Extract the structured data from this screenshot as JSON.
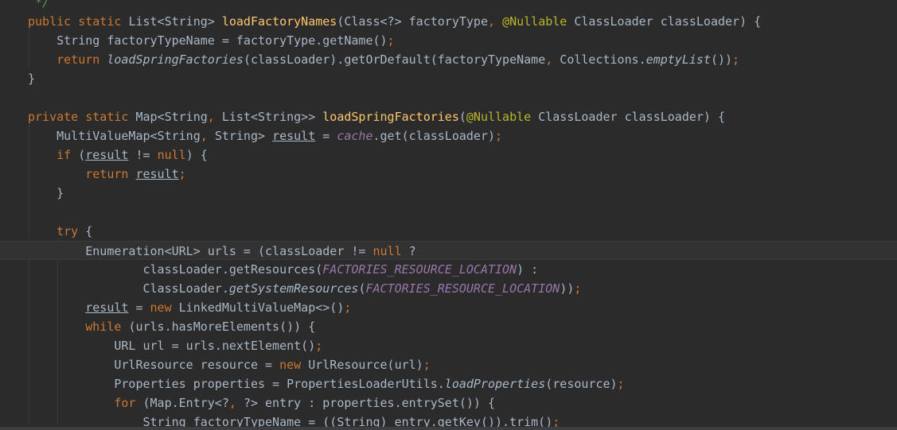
{
  "editor": {
    "lines": [
      {
        "tokens": [
          {
            "t": " */",
            "c": "cm"
          }
        ]
      },
      {
        "tokens": [
          {
            "t": "public static ",
            "c": "kw"
          },
          {
            "t": "List<String> ",
            "c": "pl"
          },
          {
            "t": "loadFactoryNames",
            "c": "fn"
          },
          {
            "t": "(Class<?> factoryType",
            "c": "pl"
          },
          {
            "t": ", ",
            "c": "kw"
          },
          {
            "t": "@Nullable ",
            "c": "ann"
          },
          {
            "t": "ClassLoader classLoader) {",
            "c": "pl"
          }
        ]
      },
      {
        "tokens": [
          {
            "t": "    String factoryTypeName = factoryType.getName()",
            "c": "pl"
          },
          {
            "t": ";",
            "c": "kw"
          }
        ]
      },
      {
        "tokens": [
          {
            "t": "    return ",
            "c": "kw"
          },
          {
            "t": "loadSpringFactories",
            "c": "it"
          },
          {
            "t": "(classLoader).getOrDefault(factoryTypeName",
            "c": "pl"
          },
          {
            "t": ", ",
            "c": "kw"
          },
          {
            "t": "Collections.",
            "c": "pl"
          },
          {
            "t": "emptyList",
            "c": "it"
          },
          {
            "t": "())",
            "c": "pl"
          },
          {
            "t": ";",
            "c": "kw"
          }
        ]
      },
      {
        "tokens": [
          {
            "t": "}",
            "c": "pl"
          }
        ]
      },
      {
        "tokens": []
      },
      {
        "tokens": [
          {
            "t": "private static ",
            "c": "kw"
          },
          {
            "t": "Map<String",
            "c": "pl"
          },
          {
            "t": ", ",
            "c": "kw"
          },
          {
            "t": "List<String>> ",
            "c": "pl"
          },
          {
            "t": "loadSpringFactories",
            "c": "fn"
          },
          {
            "t": "(",
            "c": "pl"
          },
          {
            "t": "@Nullable ",
            "c": "ann"
          },
          {
            "t": "ClassLoader classLoader) {",
            "c": "pl"
          }
        ]
      },
      {
        "tokens": [
          {
            "t": "    MultiValueMap<String",
            "c": "pl"
          },
          {
            "t": ", ",
            "c": "kw"
          },
          {
            "t": "String> ",
            "c": "pl"
          },
          {
            "t": "result",
            "c": "ul"
          },
          {
            "t": " = ",
            "c": "pl"
          },
          {
            "t": "cache",
            "c": "fld"
          },
          {
            "t": ".get(classLoader)",
            "c": "pl"
          },
          {
            "t": ";",
            "c": "kw"
          }
        ]
      },
      {
        "tokens": [
          {
            "t": "    if ",
            "c": "kw"
          },
          {
            "t": "(",
            "c": "pl"
          },
          {
            "t": "result",
            "c": "ul"
          },
          {
            "t": " != ",
            "c": "pl"
          },
          {
            "t": "null",
            "c": "kw"
          },
          {
            "t": ") {",
            "c": "pl"
          }
        ]
      },
      {
        "tokens": [
          {
            "t": "        return ",
            "c": "kw"
          },
          {
            "t": "result",
            "c": "ul"
          },
          {
            "t": ";",
            "c": "kw"
          }
        ]
      },
      {
        "tokens": [
          {
            "t": "    }",
            "c": "pl"
          }
        ]
      },
      {
        "tokens": []
      },
      {
        "tokens": [
          {
            "t": "    try ",
            "c": "kw"
          },
          {
            "t": "{",
            "c": "pl"
          }
        ]
      },
      {
        "tokens": [
          {
            "t": "        Enumeration<URL> urls = (classLoader != ",
            "c": "pl"
          },
          {
            "t": "null ",
            "c": "kw"
          },
          {
            "t": "?",
            "c": "pl"
          }
        ],
        "current": true
      },
      {
        "tokens": [
          {
            "t": "                classLoader.getResources(",
            "c": "pl"
          },
          {
            "t": "FACTORIES_RESOURCE_LOCATION",
            "c": "fld"
          },
          {
            "t": ") :",
            "c": "pl"
          }
        ]
      },
      {
        "tokens": [
          {
            "t": "                ClassLoader.",
            "c": "pl"
          },
          {
            "t": "getSystemResources",
            "c": "it"
          },
          {
            "t": "(",
            "c": "pl"
          },
          {
            "t": "FACTORIES_RESOURCE_LOCATION",
            "c": "fld"
          },
          {
            "t": "))",
            "c": "pl"
          },
          {
            "t": ";",
            "c": "kw"
          }
        ]
      },
      {
        "tokens": [
          {
            "t": "        ",
            "c": "pl"
          },
          {
            "t": "result",
            "c": "ul"
          },
          {
            "t": " = ",
            "c": "pl"
          },
          {
            "t": "new ",
            "c": "kw"
          },
          {
            "t": "LinkedMultiValueMap<>()",
            "c": "pl"
          },
          {
            "t": ";",
            "c": "kw"
          }
        ]
      },
      {
        "tokens": [
          {
            "t": "        while ",
            "c": "kw"
          },
          {
            "t": "(urls.hasMoreElements()) {",
            "c": "pl"
          }
        ]
      },
      {
        "tokens": [
          {
            "t": "            URL url = urls.nextElement()",
            "c": "pl"
          },
          {
            "t": ";",
            "c": "kw"
          }
        ]
      },
      {
        "tokens": [
          {
            "t": "            UrlResource resource = ",
            "c": "pl"
          },
          {
            "t": "new ",
            "c": "kw"
          },
          {
            "t": "UrlResource(url)",
            "c": "pl"
          },
          {
            "t": ";",
            "c": "kw"
          }
        ]
      },
      {
        "tokens": [
          {
            "t": "            Properties properties = PropertiesLoaderUtils.",
            "c": "pl"
          },
          {
            "t": "loadProperties",
            "c": "it"
          },
          {
            "t": "(resource)",
            "c": "pl"
          },
          {
            "t": ";",
            "c": "kw"
          }
        ]
      },
      {
        "tokens": [
          {
            "t": "            for ",
            "c": "kw"
          },
          {
            "t": "(Map.Entry<?",
            "c": "pl"
          },
          {
            "t": ", ",
            "c": "kw"
          },
          {
            "t": "?> entry : properties.entrySet()) {",
            "c": "pl"
          }
        ]
      },
      {
        "tokens": [
          {
            "t": "                String factoryTypeName = ((String) entry.getKey()).trim()",
            "c": "pl"
          },
          {
            "t": ";",
            "c": "kw"
          }
        ]
      }
    ]
  }
}
